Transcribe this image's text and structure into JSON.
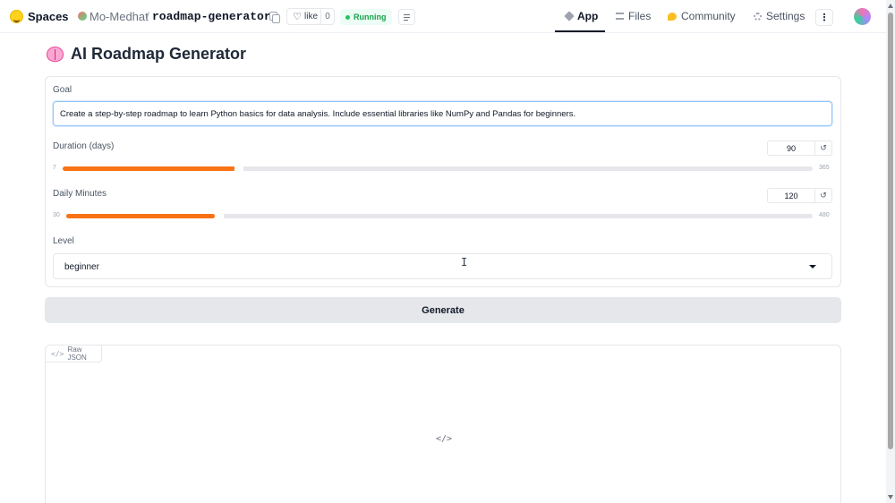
{
  "header": {
    "brand": "Spaces",
    "owner": "Mo-Medhat",
    "separator": "/",
    "repo": "roadmap-generator",
    "like_label": "like",
    "like_count": "0",
    "status": "Running",
    "nav": [
      {
        "label": "App",
        "active": true
      },
      {
        "label": "Files"
      },
      {
        "label": "Community"
      },
      {
        "label": "Settings"
      }
    ],
    "more": "⋮"
  },
  "app": {
    "title": "AI Roadmap Generator",
    "goal": {
      "label": "Goal",
      "value": "Create a step-by-step roadmap to learn Python basics for data analysis. Include essential libraries like NumPy and Pandas for beginners."
    },
    "duration": {
      "label": "Duration (days)",
      "value": "90",
      "min": "7",
      "max": "365",
      "reset": "↺"
    },
    "daily_minutes": {
      "label": "Daily Minutes",
      "value": "120",
      "min": "30",
      "max": "480",
      "reset": "↺"
    },
    "level": {
      "label": "Level",
      "selected": "beginner"
    },
    "generate_label": "Generate",
    "output": {
      "tab_label": "Raw JSON",
      "placeholder_icon": "</>"
    }
  },
  "colors": {
    "accent": "#f97316",
    "running": "#16a34a"
  },
  "icons": [
    "hf-logo-icon",
    "copy-icon",
    "heart-icon",
    "menu-icon",
    "app-icon",
    "files-icon",
    "community-icon",
    "settings-icon",
    "brain-icon",
    "reset-icon",
    "chevron-down-icon",
    "code-icon"
  ]
}
